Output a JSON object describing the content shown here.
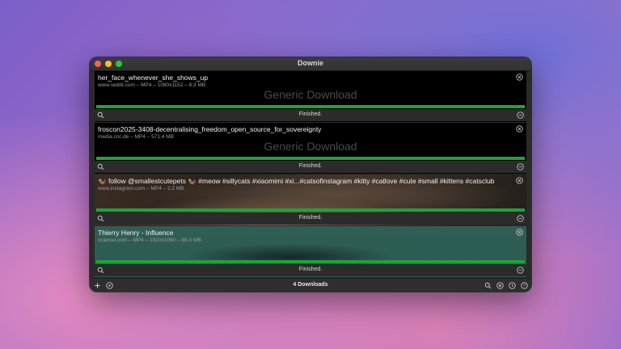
{
  "window": {
    "title": "Downie"
  },
  "downloads": [
    {
      "title": "her_face_whenever_she_shows_up",
      "meta": "www.reddit.com – MP4 – 1080x1152 – 8.3 MB",
      "watermark": "Generic Download",
      "progress": 1.0,
      "status": "Finished.",
      "thumbnail": "black"
    },
    {
      "title": "froscon2025-3408-decentralising_freedom_open_source_for_sovereignty",
      "meta": "media.ccc.de – MP4 – 571.4 MB",
      "watermark": "Generic Download",
      "progress": 1.0,
      "status": "Finished.",
      "thumbnail": "black"
    },
    {
      "title": "🦦 follow @smallestcutepets 🦦 #meow #sillycats #xiaomimi #xi...#catsofinstagram #kitty #catlove #cute #small #kittens #catsclub",
      "meta": "www.instagram.com – MP4 – 2.2 MB",
      "watermark": "",
      "progress": 1.0,
      "status": "Finished.",
      "thumbnail": "photo"
    },
    {
      "title": "Thierry Henry - Influence",
      "meta": "xcancel.com – MP4 – 1920x1080 – 88.3 MB",
      "watermark": "",
      "progress": 1.0,
      "status": "Finished.",
      "thumbnail": "teal"
    }
  ],
  "toolbar": {
    "count_label": "4 Downloads",
    "left_icons": [
      "plus-icon",
      "compass-icon"
    ],
    "right_icons": [
      "search-icon",
      "stop-icon",
      "history-icon",
      "help-icon"
    ]
  },
  "colors": {
    "progress": "#1fa23a",
    "titlebar": "#3b3b3b"
  }
}
